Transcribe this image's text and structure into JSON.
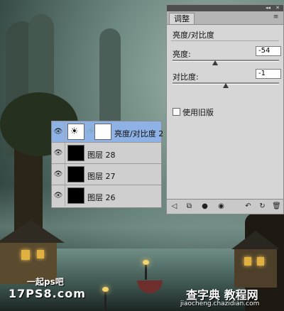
{
  "adjustments_panel": {
    "tab_label": "调整",
    "title": "亮度/对比度",
    "brightness": {
      "label": "亮度:",
      "value": "-54",
      "fraction": 0.4
    },
    "contrast": {
      "label": "对比度:",
      "value": "-1",
      "fraction": 0.5
    },
    "use_legacy_label": "使用旧版",
    "use_legacy_checked": false,
    "bottom_icons": [
      "back-icon",
      "clip-to-layer-icon",
      "visibility-icon",
      "eye-preview-icon",
      "view-previous-icon",
      "reset-icon",
      "delete-icon"
    ]
  },
  "layers_panel": {
    "layers": [
      {
        "name": "亮度/对比度 2",
        "selected": true,
        "type": "adjustment"
      },
      {
        "name": "图层 28",
        "selected": false,
        "type": "pixel"
      },
      {
        "name": "图层 27",
        "selected": false,
        "type": "pixel"
      },
      {
        "name": "图层 26",
        "selected": false,
        "type": "pixel"
      }
    ]
  },
  "watermarks": {
    "left_line1": "一起ps吧",
    "left_line2": "17PS8.com",
    "right_line1": "查字典 教程网",
    "right_line2": "jiaocheng.chazidian.com"
  },
  "colors": {
    "selected_layer": "#8fb2e6",
    "panel_bg": "#d6d6d6"
  }
}
